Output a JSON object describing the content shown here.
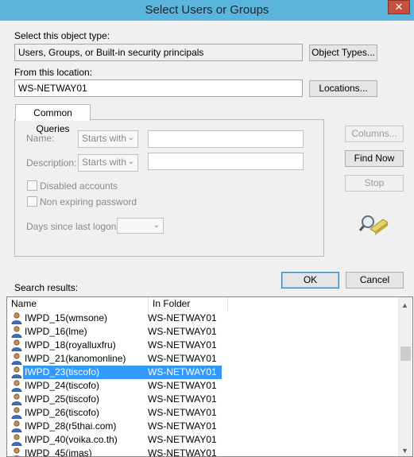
{
  "window": {
    "title": "Select Users or Groups",
    "close_glyph": "✕"
  },
  "object_type": {
    "label": "Select this object type:",
    "value": "Users, Groups, or Built-in security principals",
    "button": "Object Types..."
  },
  "location": {
    "label": "From this location:",
    "value": "WS-NETWAY01",
    "button": "Locations..."
  },
  "queries": {
    "tab": "Common Queries",
    "name_label": "Name:",
    "name_mode": "Starts with",
    "desc_label": "Description:",
    "desc_mode": "Starts with",
    "disabled_accounts": "Disabled accounts",
    "non_expiring": "Non expiring password",
    "days_label": "Days since last logon:"
  },
  "side_buttons": {
    "columns": "Columns...",
    "find_now": "Find Now",
    "stop": "Stop"
  },
  "actions": {
    "ok": "OK",
    "cancel": "Cancel"
  },
  "results": {
    "label": "Search results:",
    "columns": [
      "Name",
      "In Folder"
    ],
    "rows": [
      {
        "name": "IWPD_15(wmsone)",
        "folder": "WS-NETWAY01"
      },
      {
        "name": "IWPD_16(lme)",
        "folder": "WS-NETWAY01"
      },
      {
        "name": "IWPD_18(royalluxfru)",
        "folder": "WS-NETWAY01"
      },
      {
        "name": "IWPD_21(kanomonline)",
        "folder": "WS-NETWAY01"
      },
      {
        "name": "IWPD_23(tiscofo)",
        "folder": "WS-NETWAY01",
        "selected": true
      },
      {
        "name": "IWPD_24(tiscofo)",
        "folder": "WS-NETWAY01"
      },
      {
        "name": "IWPD_25(tiscofo)",
        "folder": "WS-NETWAY01"
      },
      {
        "name": "IWPD_26(tiscofo)",
        "folder": "WS-NETWAY01"
      },
      {
        "name": "IWPD_28(r5thai.com)",
        "folder": "WS-NETWAY01"
      },
      {
        "name": "IWPD_40(voika.co.th)",
        "folder": "WS-NETWAY01"
      },
      {
        "name": "IWPD_45(imas)",
        "folder": "WS-NETWAY01"
      }
    ]
  },
  "colors": {
    "titlebar": "#5ab4dc",
    "selection": "#3399ff",
    "close": "#c7503f"
  }
}
